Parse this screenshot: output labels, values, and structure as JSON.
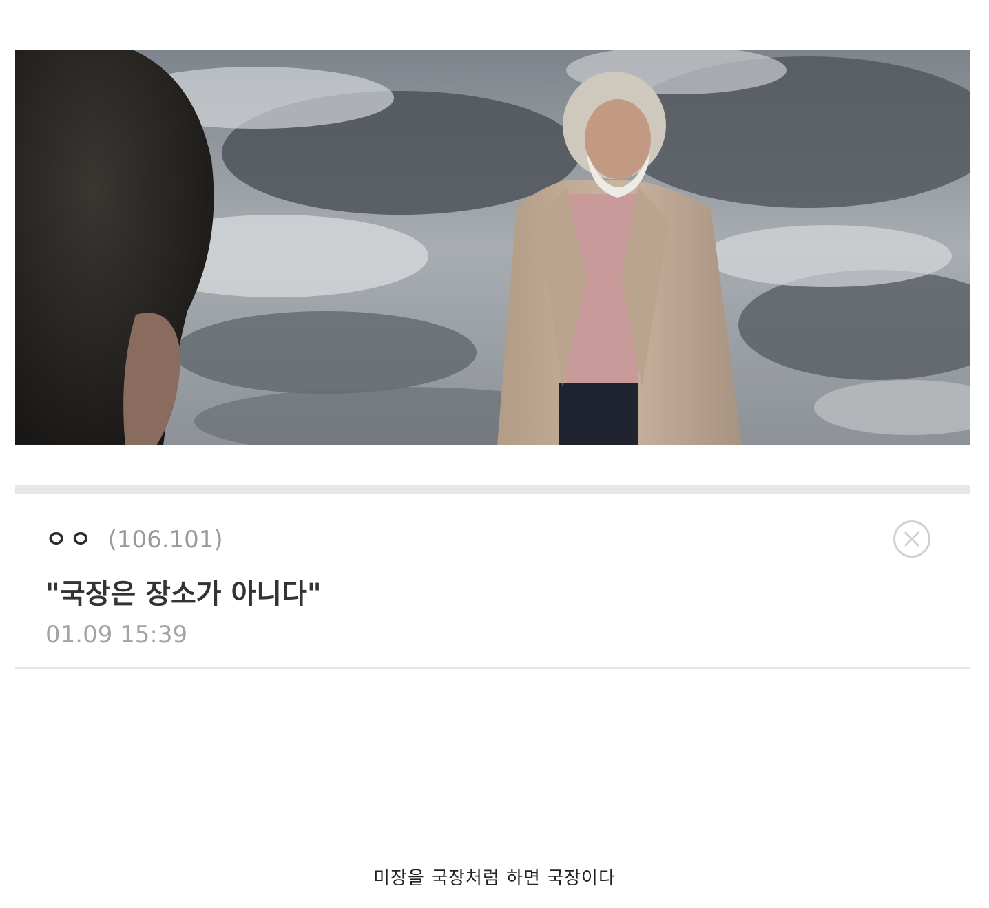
{
  "comment": {
    "author": "ㅇㅇ",
    "ip": "(106.101)",
    "text": "\"국장은 장소가 아니다\"",
    "timestamp": "01.09 15:39",
    "delete_icon": "close-circle-icon"
  },
  "caption": "미장을 국장처럼 하면 국장이다",
  "colors": {
    "divider": "#e6e7e8",
    "author": "#2b2b2b",
    "meta": "#9a9a9a",
    "body": "#333333"
  }
}
